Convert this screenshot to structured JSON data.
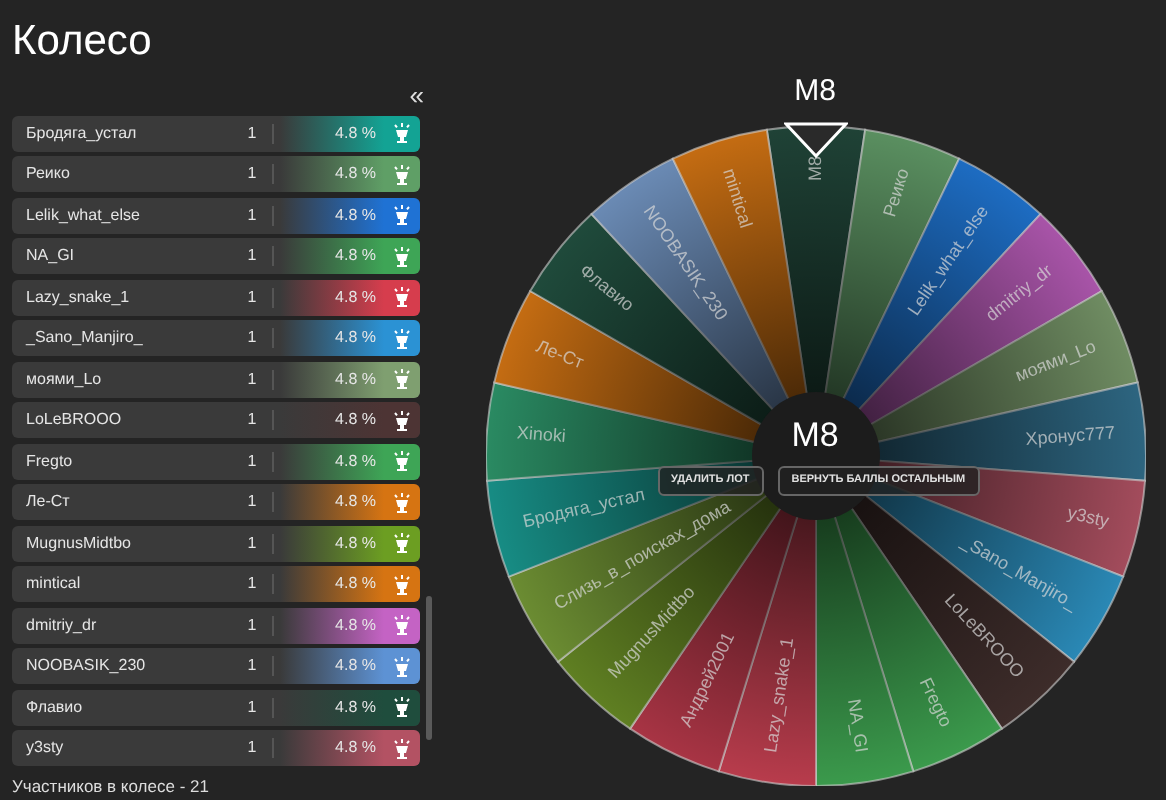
{
  "title": "Колесо",
  "collapse_button": "«",
  "participants": [
    {
      "name": "Бродяга_устал",
      "count": "1",
      "percent": "4.8 %",
      "color": "#13a394"
    },
    {
      "name": "Реико",
      "count": "1",
      "percent": "4.8 %",
      "color": "#5f9f66"
    },
    {
      "name": "Lelik_what_else",
      "count": "1",
      "percent": "4.8 %",
      "color": "#1f72d4"
    },
    {
      "name": "NA_GI",
      "count": "1",
      "percent": "4.8 %",
      "color": "#3ea556"
    },
    {
      "name": "Lazy_snake_1",
      "count": "1",
      "percent": "4.8 %",
      "color": "#d63d4d"
    },
    {
      "name": "_Sano_Manjiro_",
      "count": "1",
      "percent": "4.8 %",
      "color": "#2b92d4"
    },
    {
      "name": "моями_Lo",
      "count": "1",
      "percent": "4.8 %",
      "color": "#7f9f70"
    },
    {
      "name": "LoLeBROOO",
      "count": "1",
      "percent": "4.8 %",
      "color": "#4d3434"
    },
    {
      "name": "Fregto",
      "count": "1",
      "percent": "4.8 %",
      "color": "#3ea556"
    },
    {
      "name": "Ле-Ст",
      "count": "1",
      "percent": "4.8 %",
      "color": "#d67412"
    },
    {
      "name": "MugnusMidtbo",
      "count": "1",
      "percent": "4.8 %",
      "color": "#6c9e22"
    },
    {
      "name": "mintical",
      "count": "1",
      "percent": "4.8 %",
      "color": "#d67412"
    },
    {
      "name": "dmitriy_dr",
      "count": "1",
      "percent": "4.8 %",
      "color": "#c463c4"
    },
    {
      "name": "NOOBASIK_230",
      "count": "1",
      "percent": "4.8 %",
      "color": "#5d92d4"
    },
    {
      "name": "Флавио",
      "count": "1",
      "percent": "4.8 %",
      "color": "#1f4d3d"
    },
    {
      "name": "y3sty",
      "count": "1",
      "percent": "4.8 %",
      "color": "#b35263"
    }
  ],
  "footer": "Участников в колесе - 21",
  "winner_label": "M8",
  "center_label": "M8",
  "actions": [
    "УДАЛИТЬ ЛОТ",
    "ВЕРНУТЬ БАЛЛЫ ОСТАЛЬНЫМ"
  ],
  "wheel": [
    {
      "name": "M8",
      "color": "#1f4236"
    },
    {
      "name": "Реико",
      "color": "#5a8f60"
    },
    {
      "name": "Lelik_what_else",
      "color": "#1d6cc2"
    },
    {
      "name": "dmitriy_dr",
      "color": "#a854a8"
    },
    {
      "name": "моями_Lo",
      "color": "#6f8c62"
    },
    {
      "name": "Хронус777",
      "color": "#2d6580"
    },
    {
      "name": "y3sty",
      "color": "#a34c5c"
    },
    {
      "name": "_Sano_Manjiro_",
      "color": "#2a88b5"
    },
    {
      "name": "LoLeBROOO",
      "color": "#3d2c2a"
    },
    {
      "name": "Fregto",
      "color": "#3b9a4c"
    },
    {
      "name": "NA_GI",
      "color": "#3b9a4c"
    },
    {
      "name": "Lazy_snake_1",
      "color": "#b83c4c"
    },
    {
      "name": "Андрей2001",
      "color": "#a83444"
    },
    {
      "name": "MugnusMidtbo",
      "color": "#5f7f22"
    },
    {
      "name": "Слизь_в_поисках_дома",
      "color": "#6b8c32"
    },
    {
      "name": "Бродяга_устал",
      "color": "#178c84"
    },
    {
      "name": "Xinoki",
      "color": "#2a8a62"
    },
    {
      "name": "Ле-Ст",
      "color": "#c46c12"
    },
    {
      "name": "Флавио",
      "color": "#1f4a3b"
    },
    {
      "name": "NOOBASIK_230",
      "color": "#6a8ab4"
    },
    {
      "name": "mintical",
      "color": "#c46c12"
    }
  ]
}
